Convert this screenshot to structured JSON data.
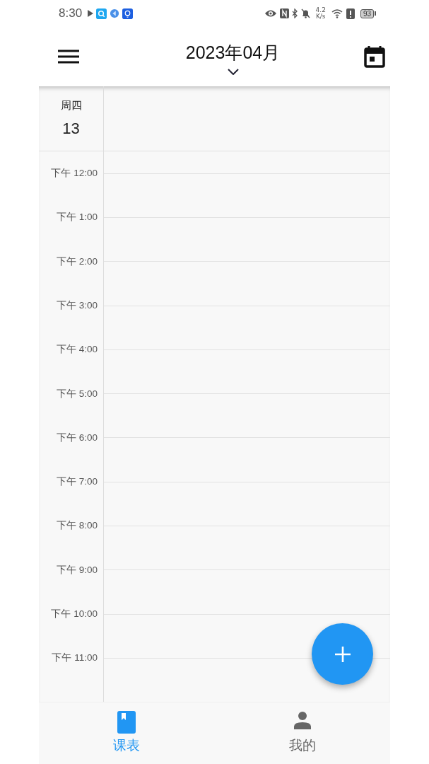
{
  "status_bar": {
    "time": "8:30",
    "speed_value": "4.2",
    "speed_unit": "K/s",
    "battery": "93"
  },
  "header": {
    "title": "2023年04月"
  },
  "day": {
    "weekday": "周四",
    "date": "13"
  },
  "hours": [
    "下午 12:00",
    "下午 1:00",
    "下午 2:00",
    "下午 3:00",
    "下午 4:00",
    "下午 5:00",
    "下午 6:00",
    "下午 7:00",
    "下午 8:00",
    "下午 9:00",
    "下午 10:00",
    "下午 11:00"
  ],
  "nav": [
    {
      "label": "课表",
      "kind": "book",
      "selected": true
    },
    {
      "label": "我的",
      "kind": "person",
      "selected": false
    }
  ]
}
